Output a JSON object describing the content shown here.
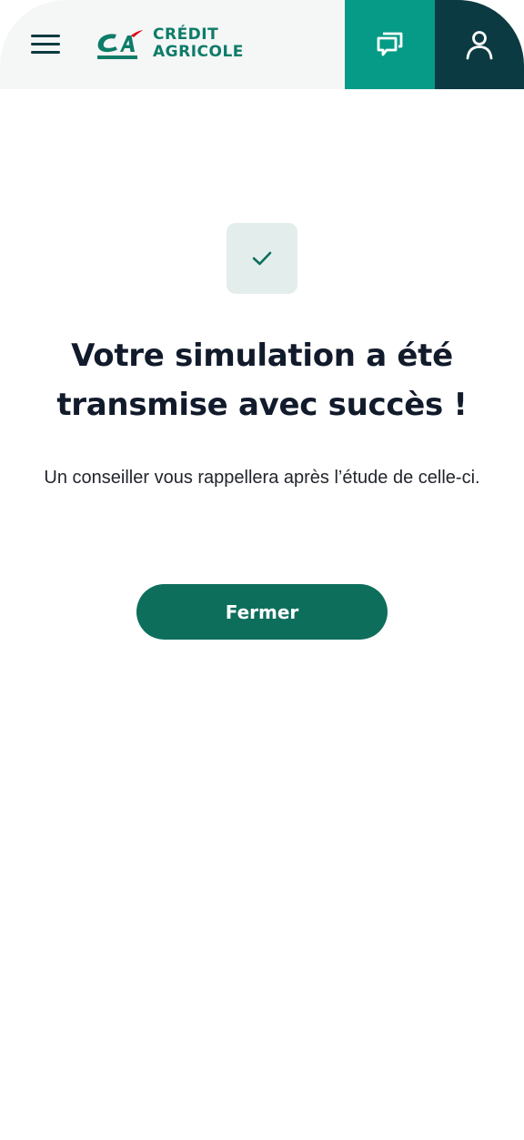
{
  "header": {
    "logo_line1": "CRÉDIT",
    "logo_line2": "AGRICOLE",
    "brand_colors": {
      "green": "#0d7c68",
      "red": "#e2001a",
      "chat_bg": "#069b86",
      "account_bg": "#0b3a42"
    },
    "icons": {
      "menu": "hamburger-menu-icon",
      "chat": "chat-bubbles-icon",
      "account": "user-icon",
      "logo": "credit-agricole-logo"
    }
  },
  "confirmation": {
    "icon": "checkmark-icon",
    "title": "Votre simulation a été transmise avec succès !",
    "message": "Un conseiller vous rappellera après l’étude de celle-ci.",
    "close_label": "Fermer"
  }
}
